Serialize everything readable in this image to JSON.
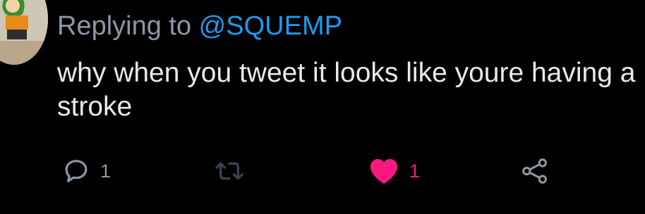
{
  "reply": {
    "prefix": "Replying to ",
    "handle": "@SQUEMP"
  },
  "tweet": {
    "text": "why when you tweet it looks like youre having a stroke"
  },
  "actions": {
    "reply": {
      "icon": "comment-icon",
      "count": "1"
    },
    "retweet": {
      "icon": "retweet-icon"
    },
    "like": {
      "icon": "heart-icon",
      "count": "1",
      "liked": true
    },
    "share": {
      "icon": "share-icon"
    }
  },
  "colors": {
    "background": "#000000",
    "secondary_text": "#8b98a5",
    "primary_text": "#e7e9ea",
    "link": "#1d9bf0",
    "like": "#f91880"
  }
}
